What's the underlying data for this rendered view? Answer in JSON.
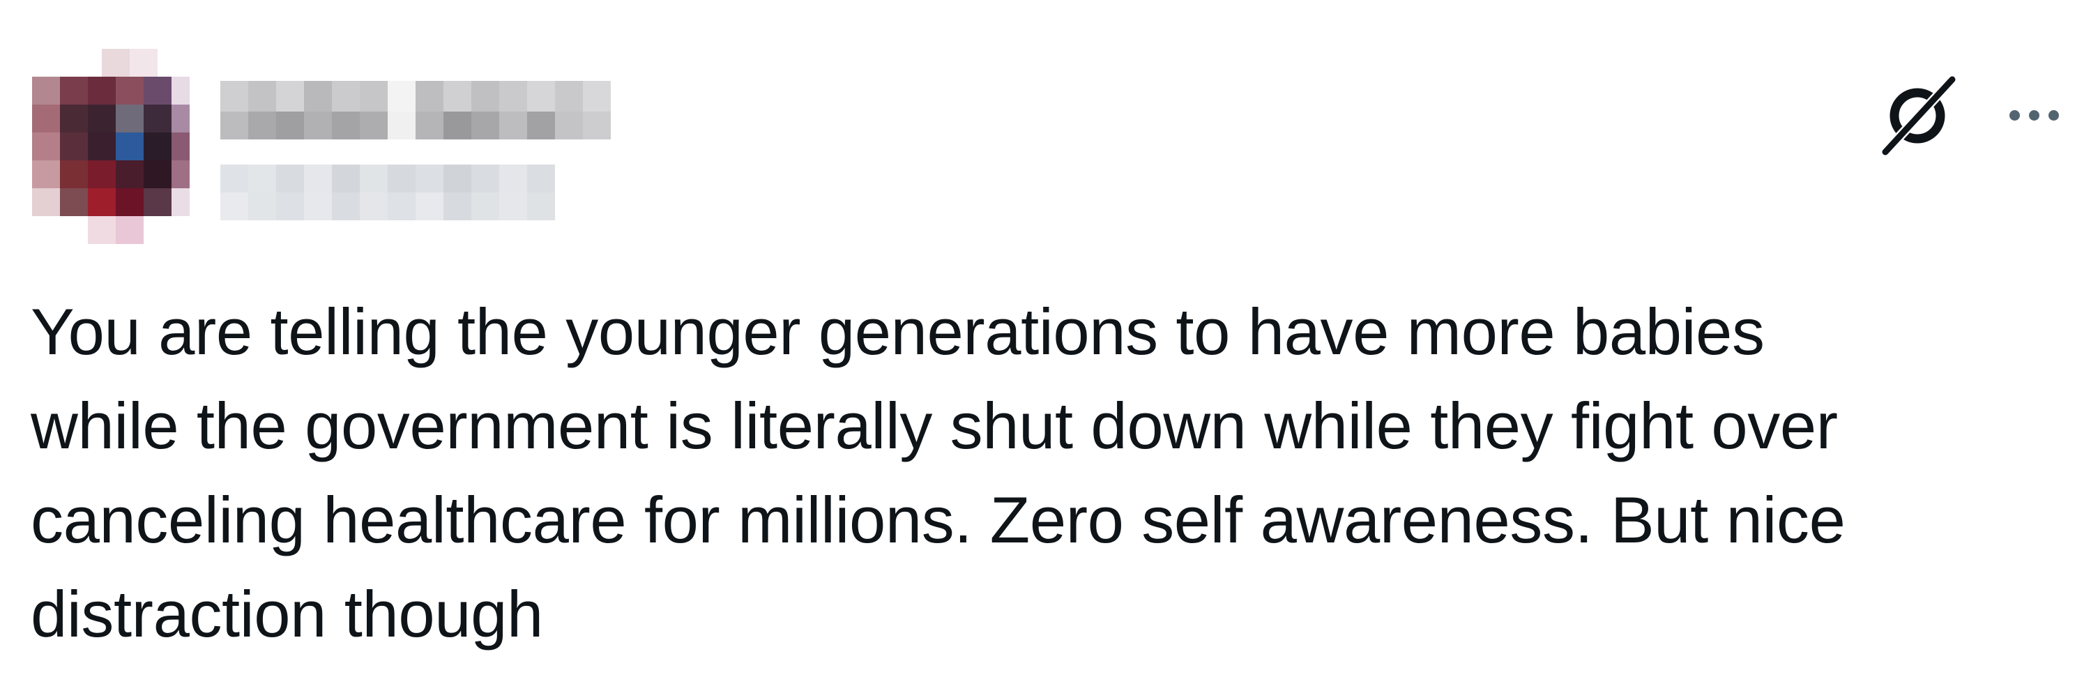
{
  "post": {
    "author_name": "",
    "author_handle": "",
    "text_lines": [
      "You are telling the younger generations to have more babies",
      "while the government is literally shut down while they fight over",
      "canceling healthcare for millions. Zero self awareness. But nice",
      "distraction though"
    ]
  },
  "icons": {
    "avatar": "pixelated-avatar",
    "author": "pixelated-author-name",
    "grok": "grok-icon",
    "more": "more-icon"
  },
  "colors": {
    "text": "#0f1419",
    "icon": "#0f1419",
    "muted": "#536471",
    "background": "#ffffff"
  }
}
